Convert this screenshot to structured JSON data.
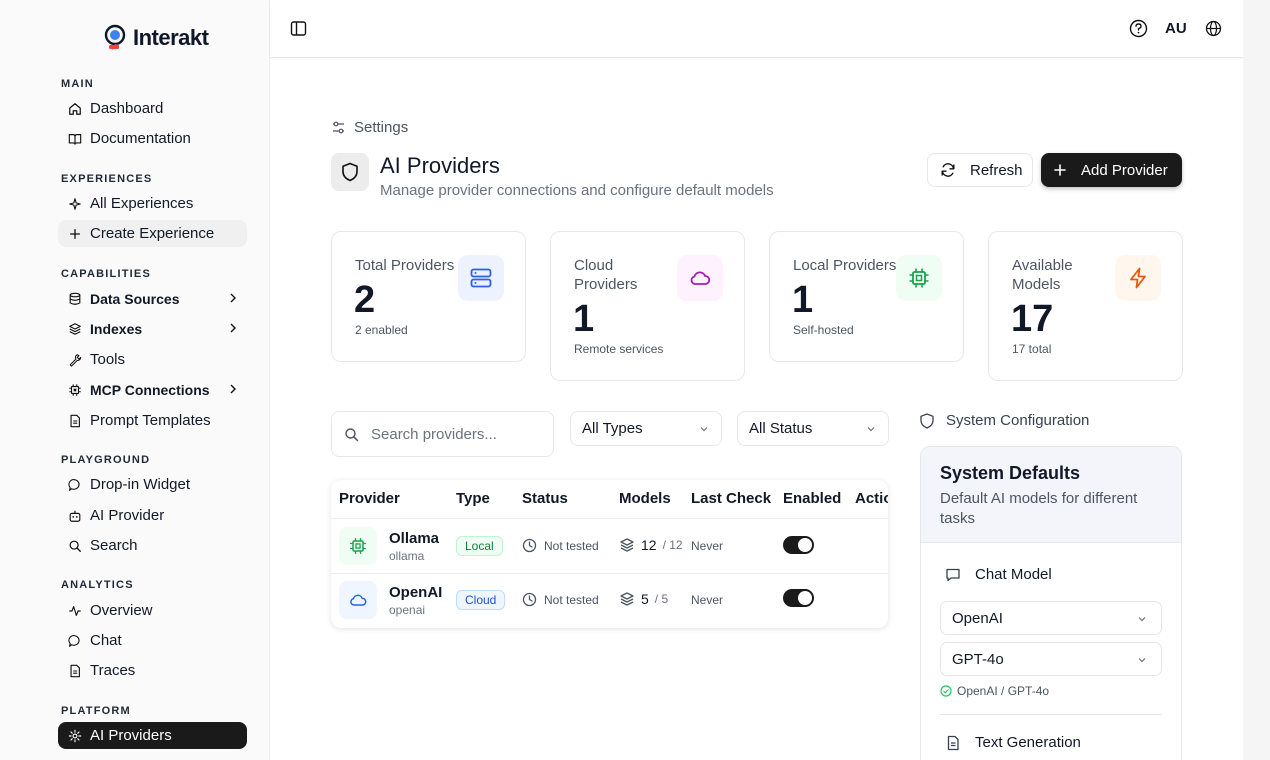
{
  "brand": {
    "name": "Interakt"
  },
  "sidebar": {
    "sections": [
      {
        "title": "MAIN",
        "items": [
          {
            "label": "Dashboard",
            "icon": "home-icon"
          },
          {
            "label": "Documentation",
            "icon": "book-icon"
          }
        ]
      },
      {
        "title": "EXPERIENCES",
        "items": [
          {
            "label": "All Experiences",
            "icon": "sparkle-icon"
          },
          {
            "label": "Create Experience",
            "icon": "plus-icon"
          }
        ]
      },
      {
        "title": "CAPABILITIES",
        "items": [
          {
            "label": "Data Sources",
            "icon": "database-icon"
          },
          {
            "label": "Indexes",
            "icon": "layers-icon"
          },
          {
            "label": "Tools",
            "icon": "wrench-icon"
          },
          {
            "label": "MCP Connections",
            "icon": "chip-icon"
          },
          {
            "label": "Prompt Templates",
            "icon": "file-icon"
          }
        ]
      },
      {
        "title": "PLAYGROUND",
        "items": [
          {
            "label": "Drop-in Widget",
            "icon": "message-icon"
          },
          {
            "label": "AI Provider",
            "icon": "robot-icon"
          },
          {
            "label": "Search",
            "icon": "search-icon"
          }
        ]
      },
      {
        "title": "ANALYTICS",
        "items": [
          {
            "label": "Overview",
            "icon": "activity-icon"
          },
          {
            "label": "Chat",
            "icon": "chat-icon"
          },
          {
            "label": "Traces",
            "icon": "file-icon"
          }
        ]
      },
      {
        "title": "PLATFORM",
        "items": [
          {
            "label": "AI Providers",
            "icon": "settings-icon"
          }
        ]
      }
    ]
  },
  "topbar": {
    "user_initials": "AU"
  },
  "breadcrumb": {
    "label": "Settings"
  },
  "page": {
    "title": "AI Providers",
    "subtitle": "Manage provider connections and configure default models",
    "refresh_label": "Refresh",
    "add_label": "Add Provider"
  },
  "stats": [
    {
      "label": "Total Providers",
      "value": "2",
      "sub": "2 enabled",
      "icon": "server-icon",
      "color": "#2563eb",
      "bg": "#eef2ff"
    },
    {
      "label": "Cloud Providers",
      "value": "1",
      "sub": "Remote services",
      "icon": "cloud-icon",
      "color": "#a21caf",
      "bg": "#fdf2fe"
    },
    {
      "label": "Local Providers",
      "value": "1",
      "sub": "Self-hosted",
      "icon": "chip-icon",
      "color": "#16a34a",
      "bg": "#f0fdf4"
    },
    {
      "label": "Available Models",
      "value": "17",
      "sub": "17 total",
      "icon": "bolt-icon",
      "color": "#ea580c",
      "bg": "#fff7ed"
    }
  ],
  "filters": {
    "search_placeholder": "Search providers...",
    "type_value": "All Types",
    "status_value": "All Status"
  },
  "table": {
    "headers": [
      "Provider",
      "Type",
      "Status",
      "Models",
      "Last Check",
      "Enabled",
      "Actions"
    ],
    "rows": [
      {
        "name": "Ollama",
        "id": "ollama",
        "type": "Local",
        "status": "Not tested",
        "models": "12",
        "models_total": "/ 12",
        "last_check": "Never",
        "enabled": true
      },
      {
        "name": "OpenAI",
        "id": "openai",
        "type": "Cloud",
        "status": "Not tested",
        "models": "5",
        "models_total": "/ 5",
        "last_check": "Never",
        "enabled": true
      }
    ]
  },
  "system": {
    "header": "System Configuration",
    "title": "System Defaults",
    "description": "Default AI models for different tasks",
    "chat_model": {
      "label": "Chat Model",
      "provider": "OpenAI",
      "model": "GPT-4o",
      "selection": "OpenAI / GPT-4o"
    },
    "text_generation_label": "Text Generation"
  }
}
